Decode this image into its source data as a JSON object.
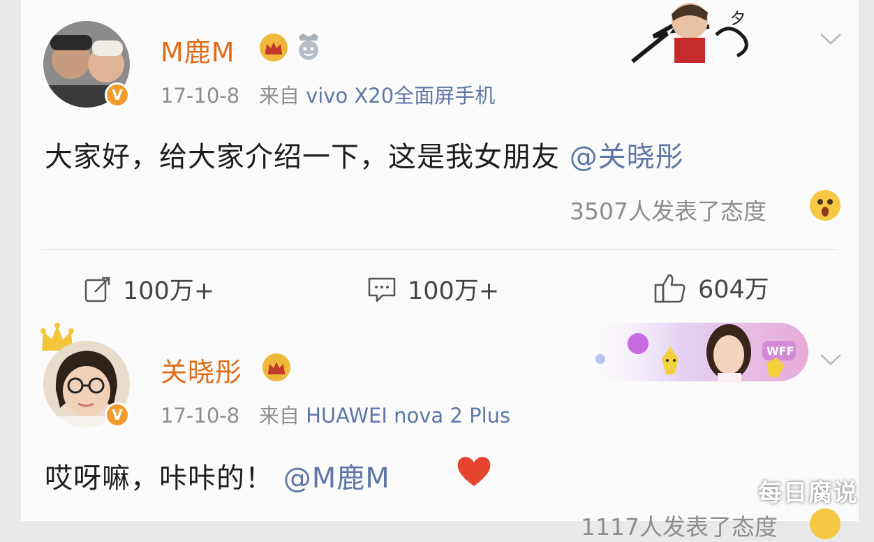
{
  "post1": {
    "name": "M鹿M",
    "meta_date": "17-10-8",
    "meta_from": "来自",
    "meta_device": "vivo X20全面屏手机",
    "text": "大家好，给大家介绍一下，这是我女朋友",
    "mention": "@关晓彤",
    "attitude_text": "3507人发表了态度"
  },
  "actions": {
    "repost": "100万+",
    "comment": "100万+",
    "like": "604万"
  },
  "post2": {
    "name": "关晓彤",
    "meta_date": "17-10-8",
    "meta_from": "来自",
    "meta_device": "HUAWEI nova 2 Plus",
    "text": "哎呀嘛，咔咔的！",
    "mention": "@M鹿M",
    "attitude_text_partial": "1117人发表了态度"
  },
  "badges": {
    "verified": "V"
  },
  "colors": {
    "name": "#e06c18",
    "link": "#5f77a6",
    "meta": "#8d8d8d",
    "verified": "#f19d2e"
  },
  "icons": [
    "crown-icon",
    "vip-badge-icon",
    "chevron-down-icon",
    "repost-icon",
    "comment-icon",
    "like-icon",
    "surprised-emoji-icon",
    "heart-emoji-icon"
  ],
  "watermark": "每日腐说"
}
